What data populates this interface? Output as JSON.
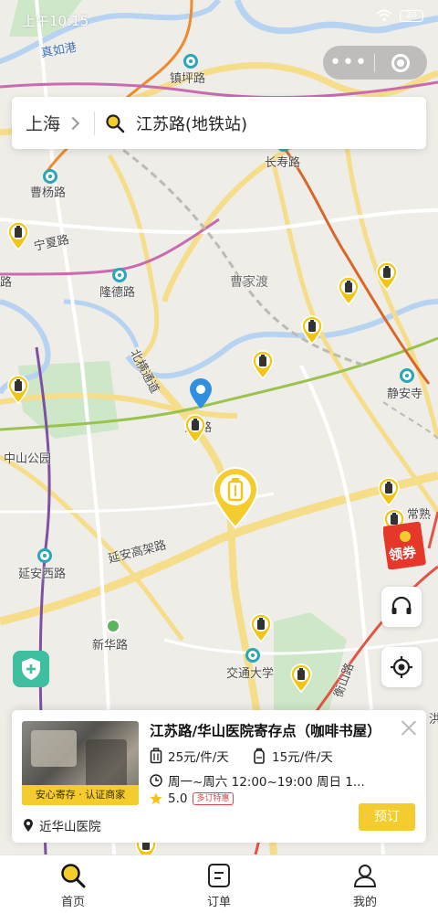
{
  "status_bar": {
    "time": "上午10:15",
    "battery": "20"
  },
  "search": {
    "city": "上海",
    "query": "江苏路(地铁站)"
  },
  "map": {
    "labels": {
      "zhenru_gang": "真如港",
      "zhenping_lu": "镇坪路",
      "changshou_lu": "长寿路",
      "caoyang_lu": "曹杨路",
      "ningxia_lu": "宁夏路",
      "lu_left": "路",
      "longde_lu": "隆德路",
      "caojiadu": "曹家渡",
      "beihenbin_lu": "北横通道",
      "jingan_si": "静安寺",
      "jiangsu_lu_partial": "江  路",
      "zhongshan_gongyuan": "中山公园",
      "yanan_gaojia": "延安高架路",
      "yanan_xilu": "延安西路",
      "xinhua_lu": "新华路",
      "jiaotong_daxue": "交通大学",
      "hengshan_lu": "衡山路",
      "right_edge_1": "常熟",
      "right_edge_2": "洪"
    }
  },
  "coupon": {
    "label": "领券"
  },
  "store_card": {
    "title": "江苏路/华山医院寄存点（咖啡书屋）",
    "badge": "安心寄存 · 认证商家",
    "price_large": "25元/件/天",
    "price_small": "15元/件/天",
    "hours": "周一~周六 12:00~19:00 周日 1...",
    "rating": "5.0",
    "promo_tag": "多订特惠",
    "nearby": "近华山医院",
    "book_button": "预订"
  },
  "tabs": [
    {
      "label": "首页",
      "icon": "home-search-icon",
      "active": true
    },
    {
      "label": "订单",
      "icon": "order-icon",
      "active": false
    },
    {
      "label": "我的",
      "icon": "profile-icon",
      "active": false
    }
  ],
  "colors": {
    "brand_yellow": "#f5cc2e",
    "metro_teal": "#2aa6b9",
    "shield_green": "#3dbfa0",
    "promo_red": "#e14646"
  }
}
